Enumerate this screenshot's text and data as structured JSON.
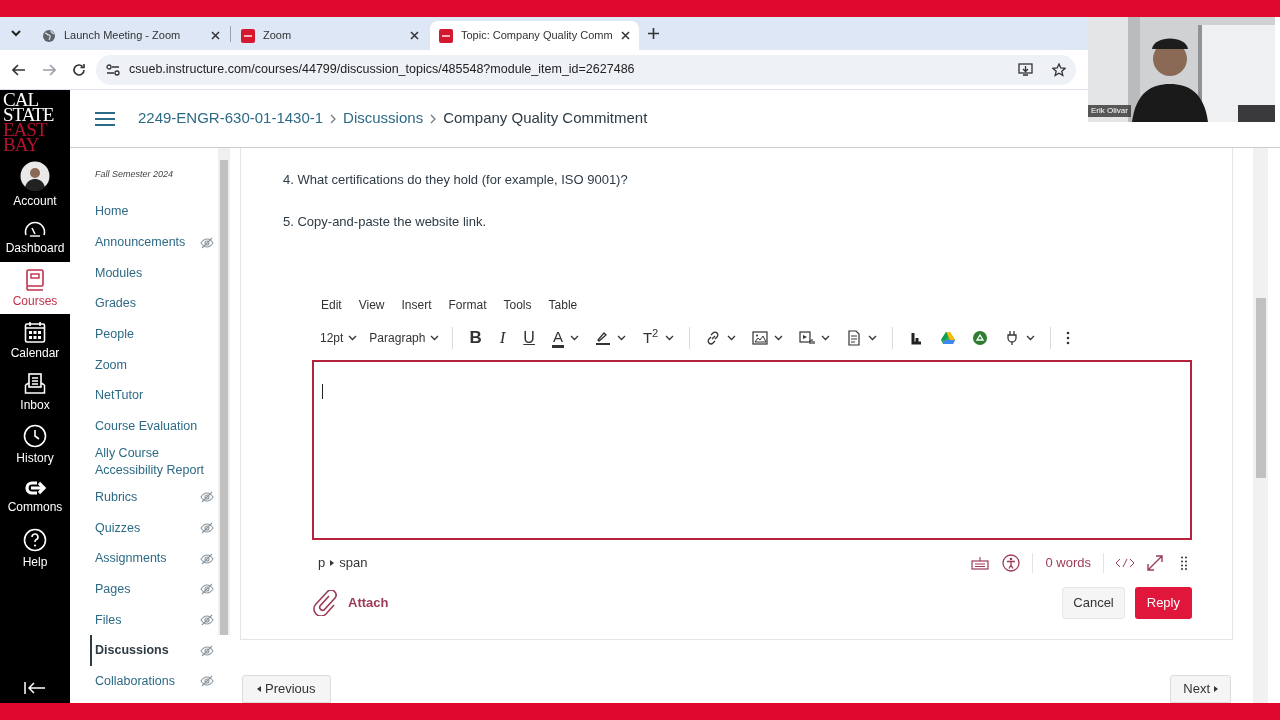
{
  "browser": {
    "tabs": [
      {
        "title": "Launch Meeting - Zoom",
        "selected": false
      },
      {
        "title": "Zoom",
        "selected": false
      },
      {
        "title": "Topic: Company Quality Comm",
        "selected": true
      }
    ],
    "url": "csueb.instructure.com/courses/44799/discussion_topics/485548?module_item_id=2627486"
  },
  "video": {
    "kind": "picture",
    "name_label": "Erik Olivar"
  },
  "logo": {
    "line_1": "CAL",
    "line_2": "STATE",
    "line_3": "EAST",
    "line_4": "BAY"
  },
  "global_nav": [
    {
      "label": "Account",
      "selected": false
    },
    {
      "label": "Dashboard",
      "selected": false
    },
    {
      "label": "Courses",
      "selected": true
    },
    {
      "label": "Calendar",
      "selected": false
    },
    {
      "label": "Inbox",
      "selected": false
    },
    {
      "label": "History",
      "selected": false
    },
    {
      "label": "Commons",
      "selected": false
    },
    {
      "label": "Help",
      "selected": false
    }
  ],
  "breadcrumbs": [
    "2249-ENGR-630-01-1430-1",
    "Discussions",
    "Company Quality Commitment"
  ],
  "course_nav": {
    "term": "Fall Semester 2024",
    "items": [
      {
        "label": "Home",
        "hidden": false,
        "selected": false
      },
      {
        "label": "Announcements",
        "hidden": true,
        "selected": false
      },
      {
        "label": "Modules",
        "hidden": false,
        "selected": false
      },
      {
        "label": "Grades",
        "hidden": false,
        "selected": false
      },
      {
        "label": "People",
        "hidden": false,
        "selected": false
      },
      {
        "label": "Zoom",
        "hidden": false,
        "selected": false
      },
      {
        "label": "NetTutor",
        "hidden": false,
        "selected": false
      },
      {
        "label": "Course Evaluation",
        "hidden": false,
        "selected": false
      },
      {
        "label": "Ally Course Accessibility Report",
        "hidden": false,
        "selected": false
      },
      {
        "label": "Rubrics",
        "hidden": true,
        "selected": false
      },
      {
        "label": "Quizzes",
        "hidden": true,
        "selected": false
      },
      {
        "label": "Assignments",
        "hidden": true,
        "selected": false
      },
      {
        "label": "Pages",
        "hidden": true,
        "selected": false
      },
      {
        "label": "Files",
        "hidden": true,
        "selected": false
      },
      {
        "label": "Discussions",
        "hidden": true,
        "selected": true
      },
      {
        "label": "Collaborations",
        "hidden": true,
        "selected": false
      }
    ]
  },
  "content": {
    "paragraphs": [
      "4. What certifications do they hold (for example, ISO 9001)?",
      "5. Copy-and-paste the website link."
    ]
  },
  "editor": {
    "menu": [
      "Edit",
      "View",
      "Insert",
      "Format",
      "Tools",
      "Table"
    ],
    "toolbar_groups": [
      [
        {
          "kind": "select",
          "label": "12pt"
        },
        {
          "kind": "select",
          "label": "Paragraph"
        }
      ],
      [
        {
          "kind": "text",
          "label": "B",
          "caret": false
        },
        {
          "kind": "text",
          "label": "I",
          "caret": false
        },
        {
          "kind": "text",
          "label": "U",
          "caret": false
        },
        {
          "kind": "text",
          "label": "A",
          "caret": true
        },
        {
          "kind": "icon",
          "caret": true
        },
        {
          "kind": "text",
          "label": "T$^{2}$",
          "caret": true
        }
      ],
      [
        {
          "kind": "icon",
          "caret": true
        },
        {
          "kind": "icon",
          "caret": true
        },
        {
          "kind": "icon",
          "caret": true
        },
        {
          "kind": "icon",
          "caret": true
        }
      ],
      [
        {
          "kind": "icon",
          "caret": false
        },
        {
          "kind": "icon",
          "caret": false
        },
        {
          "kind": "icon",
          "caret": false
        },
        {
          "kind": "icon",
          "caret": true
        }
      ],
      [
        {
          "kind": "icon",
          "caret": false
        }
      ]
    ],
    "path": [
      "p",
      "span"
    ],
    "word_count": "0 words",
    "attach": "Attach",
    "cancel": "Cancel",
    "reply": "Reply"
  },
  "pager": {
    "previous": "Previous",
    "next": "Next"
  }
}
